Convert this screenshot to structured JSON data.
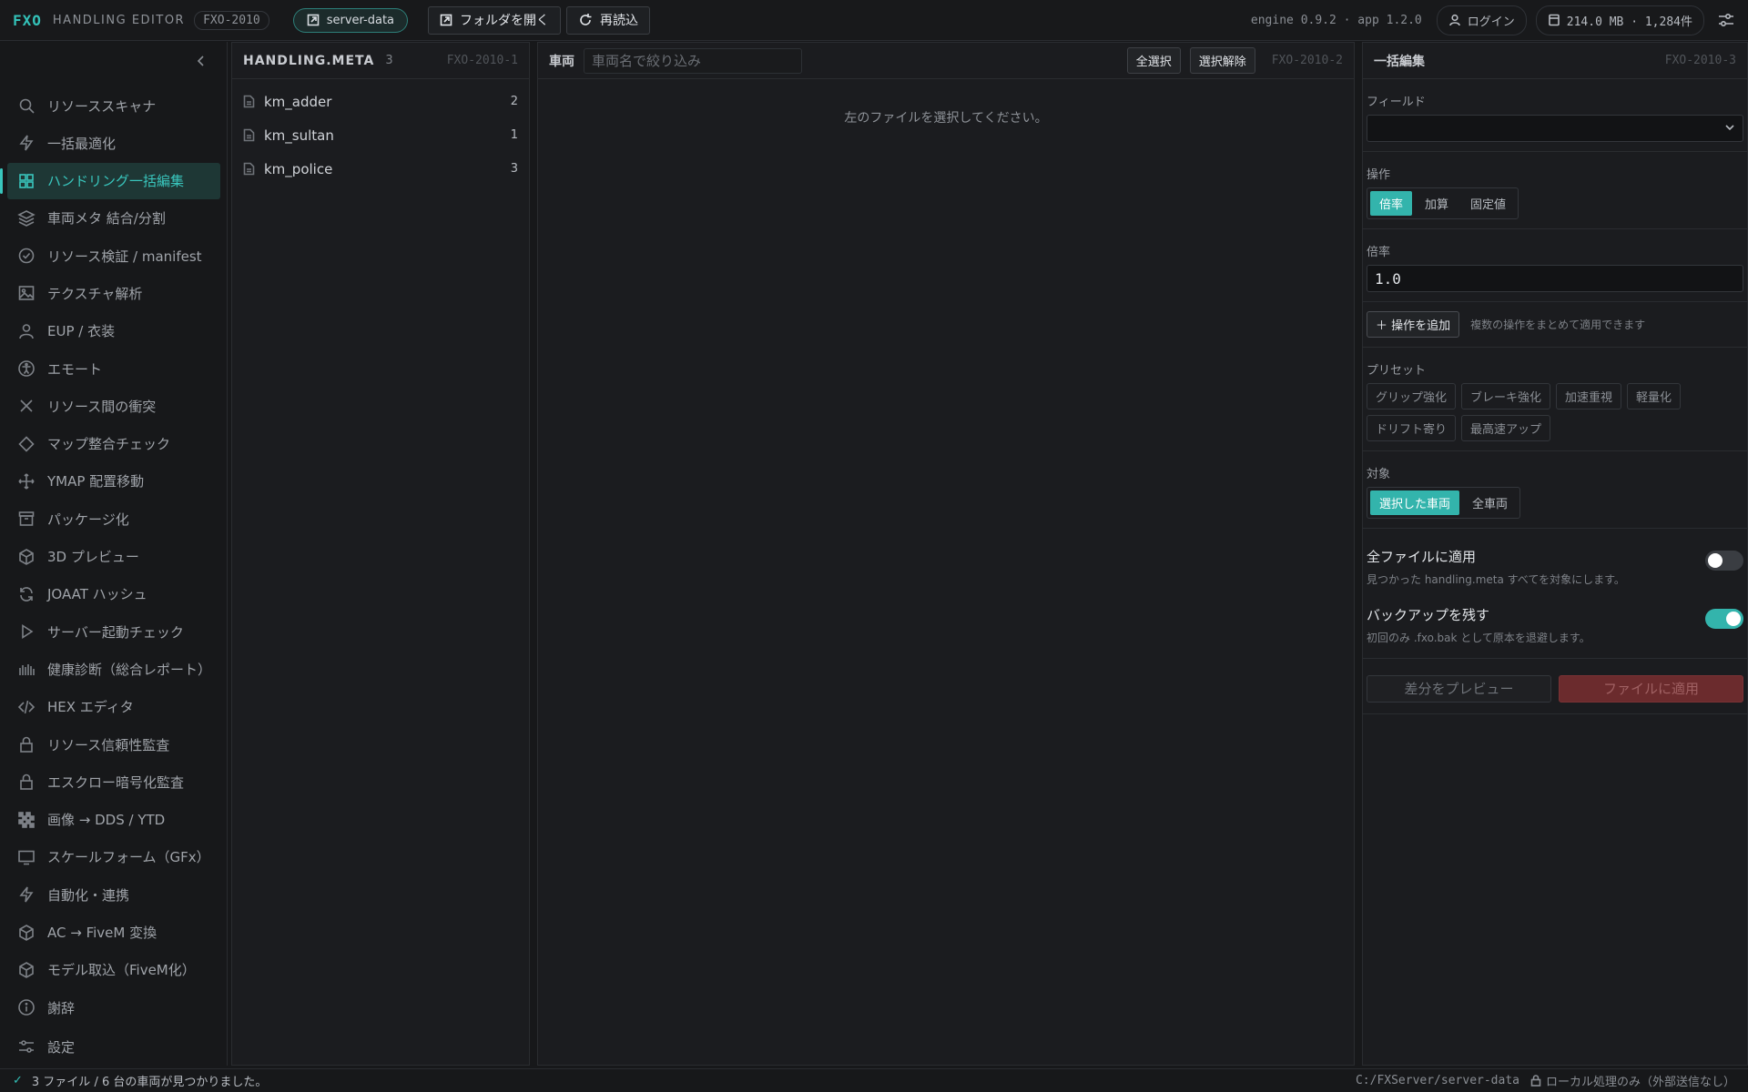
{
  "topbar": {
    "logo": "FXO",
    "app_name": "HANDLING EDITOR",
    "app_id": "FXO-2010",
    "server_pill": "server-data",
    "open_folder": "フォルダを開く",
    "reload": "再読込",
    "version": "engine 0.9.2 · app 1.2.0",
    "login": "ログイン",
    "memory": "214.0 MB · 1,284件"
  },
  "sidebar": {
    "items": [
      {
        "label": "リソーススキャナ",
        "icon": "search-icon"
      },
      {
        "label": "一括最適化",
        "icon": "bolt-icon"
      },
      {
        "label": "ハンドリング一括編集",
        "icon": "grid-icon"
      },
      {
        "label": "車両メタ 結合/分割",
        "icon": "layers-icon"
      },
      {
        "label": "リソース検証 / manifest",
        "icon": "check-circle-icon"
      },
      {
        "label": "テクスチャ解析",
        "icon": "image-icon"
      },
      {
        "label": "EUP / 衣装",
        "icon": "user-icon"
      },
      {
        "label": "エモート",
        "icon": "accessibility-icon"
      },
      {
        "label": "リソース間の衝突",
        "icon": "x-icon"
      },
      {
        "label": "マップ整合チェック",
        "icon": "diamond-icon"
      },
      {
        "label": "YMAP 配置移動",
        "icon": "move-icon"
      },
      {
        "label": "パッケージ化",
        "icon": "package-icon"
      },
      {
        "label": "3D プレビュー",
        "icon": "cube-icon"
      },
      {
        "label": "JOAAT ハッシュ",
        "icon": "refresh-icon"
      },
      {
        "label": "サーバー起動チェック",
        "icon": "play-icon"
      },
      {
        "label": "健康診断（総合レポート）",
        "icon": "bars-icon"
      },
      {
        "label": "HEX エディタ",
        "icon": "code-icon"
      },
      {
        "label": "リソース信頼性監査",
        "icon": "lock-icon"
      },
      {
        "label": "エスクロー暗号化監査",
        "icon": "lock-icon"
      },
      {
        "label": "画像 → DDS / YTD",
        "icon": "checker-icon"
      },
      {
        "label": "スケールフォーム（GFx）",
        "icon": "monitor-icon"
      },
      {
        "label": "自動化・連携",
        "icon": "bolt-icon"
      },
      {
        "label": "AC → FiveM 変換",
        "icon": "cube-icon"
      },
      {
        "label": "モデル取込（FiveM化）",
        "icon": "cube-icon"
      },
      {
        "label": "謝辞",
        "icon": "info-icon"
      },
      {
        "label": "設定",
        "icon": "sliders-icon"
      }
    ]
  },
  "files_panel": {
    "title": "HANDLING.META",
    "count": "3",
    "code": "FXO-2010-1",
    "files": [
      {
        "name": "km_adder",
        "count": "2"
      },
      {
        "name": "km_sultan",
        "count": "1"
      },
      {
        "name": "km_police",
        "count": "3"
      }
    ]
  },
  "vehicles_panel": {
    "label": "車両",
    "filter_placeholder": "車両名で絞り込み",
    "select_all": "全選択",
    "deselect": "選択解除",
    "code": "FXO-2010-2",
    "empty": "左のファイルを選択してください。"
  },
  "bulk_panel": {
    "title": "一括編集",
    "code": "FXO-2010-3",
    "field_label": "フィールド",
    "op_label": "操作",
    "ops": [
      "倍率",
      "加算",
      "固定値"
    ],
    "rate_label": "倍率",
    "rate_value": "1.0",
    "add_op": "操作を追加",
    "add_hint": "複数の操作をまとめて適用できます",
    "preset_label": "プリセット",
    "presets": [
      "グリップ強化",
      "ブレーキ強化",
      "加速重視",
      "軽量化",
      "ドリフト寄り",
      "最高速アップ"
    ],
    "target_label": "対象",
    "targets": [
      "選択した車両",
      "全車両"
    ],
    "all_files_title": "全ファイルに適用",
    "all_files_desc": "見つかった handling.meta すべてを対象にします。",
    "backup_title": "バックアップを残す",
    "backup_desc": "初回のみ .fxo.bak として原本を退避します。",
    "preview_btn": "差分をプレビュー",
    "apply_btn": "ファイルに適用"
  },
  "statusbar": {
    "message": "3 ファイル / 6 台の車両が見つかりました。",
    "path": "C:/FXServer/server-data",
    "privacy": "ローカル処理のみ（外部送信なし）"
  },
  "colors": {
    "accent": "#33c1b8",
    "danger": "#6b2b2d",
    "bg": "#17181a"
  }
}
